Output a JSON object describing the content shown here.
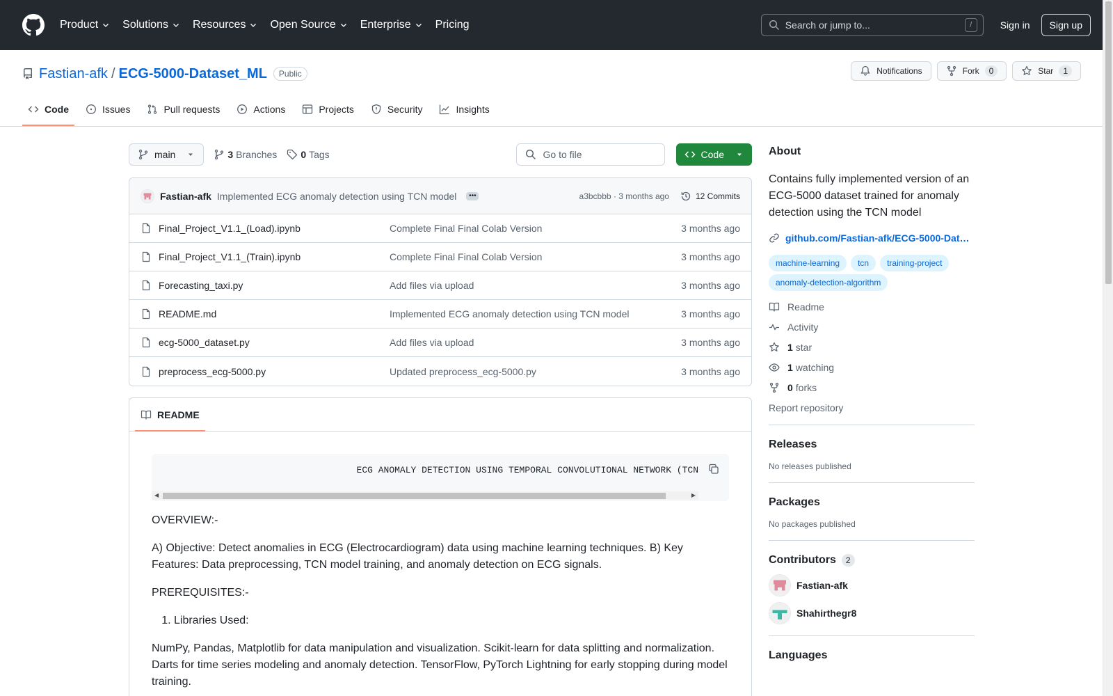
{
  "header": {
    "nav": [
      "Product",
      "Solutions",
      "Resources",
      "Open Source",
      "Enterprise",
      "Pricing"
    ],
    "search_placeholder": "Search or jump to...",
    "search_shortcut": "/",
    "signin": "Sign in",
    "signup": "Sign up"
  },
  "repo": {
    "owner": "Fastian-afk",
    "separator": "/",
    "name": "ECG-5000-Dataset_ML",
    "visibility": "Public",
    "notifications": "Notifications",
    "fork_label": "Fork",
    "fork_count": "0",
    "star_label": "Star",
    "star_count": "1"
  },
  "tabs": [
    "Code",
    "Issues",
    "Pull requests",
    "Actions",
    "Projects",
    "Security",
    "Insights"
  ],
  "toolbar": {
    "branch": "main",
    "branches_count": "3",
    "branches_label": "Branches",
    "tags_count": "0",
    "tags_label": "Tags",
    "goto_placeholder": "Go to file",
    "code_button": "Code"
  },
  "commit": {
    "author": "Fastian-afk",
    "message": "Implemented ECG anomaly detection using TCN model",
    "hash": "a3bcbbb",
    "dot": "·",
    "time": "3 months ago",
    "commits": "12 Commits"
  },
  "files": [
    {
      "name": "Final_Project_V1.1_(Load).ipynb",
      "message": "Complete Final Final Colab Version",
      "date": "3 months ago"
    },
    {
      "name": "Final_Project_V1.1_(Train).ipynb",
      "message": "Complete Final Final Colab Version",
      "date": "3 months ago"
    },
    {
      "name": "Forecasting_taxi.py",
      "message": "Add files via upload",
      "date": "3 months ago"
    },
    {
      "name": "README.md",
      "message": "Implemented ECG anomaly detection using TCN model",
      "date": "3 months ago"
    },
    {
      "name": "ecg-5000_dataset.py",
      "message": "Add files via upload",
      "date": "3 months ago"
    },
    {
      "name": "preprocess_ecg-5000.py",
      "message": "Updated preprocess_ecg-5000.py",
      "date": "3 months ago"
    }
  ],
  "readme": {
    "tab": "README",
    "code_line": "ECG ANOMALY DETECTION USING TEMPORAL CONVOLUTIONAL NETWORK (TCN",
    "overview": "OVERVIEW:-",
    "objective": "A) Objective: Detect anomalies in ECG (Electrocardiogram) data using machine learning techniques. B) Key Features: Data preprocessing, TCN model training, and anomaly detection on ECG signals.",
    "prereq": "PREREQUISITES:-",
    "list_item": "Libraries Used:",
    "libs": "NumPy, Pandas, Matplotlib for data manipulation and visualization. Scikit-learn for data splitting and normalization. Darts for time series modeling and anomaly detection. TensorFlow, PyTorch Lightning for early stopping during model training."
  },
  "sidebar": {
    "about_title": "About",
    "description": "Contains fully implemented version of an ECG-5000 dataset trained for anomaly detection using the TCN model",
    "homepage": "github.com/Fastian-afk/ECG-5000-Dat…",
    "topics": [
      "machine-learning",
      "tcn",
      "training-project",
      "anomaly-detection-algorithm"
    ],
    "readme": "Readme",
    "activity": "Activity",
    "stars_count": "1",
    "stars_label": "star",
    "watching_count": "1",
    "watching_label": "watching",
    "forks_count": "0",
    "forks_label": "forks",
    "report": "Report repository",
    "releases_title": "Releases",
    "releases_text": "No releases published",
    "packages_title": "Packages",
    "packages_text": "No packages published",
    "contributors_title": "Contributors",
    "contributors_count": "2",
    "contributors": [
      "Fastian-afk",
      "Shahirthegr8"
    ],
    "languages_title": "Languages"
  },
  "colors": {
    "header_bg": "#24292f",
    "link": "#0969da",
    "code_button": "#1f883d",
    "tab_underline": "#fd8c73",
    "topic_bg": "#ddf4ff"
  }
}
